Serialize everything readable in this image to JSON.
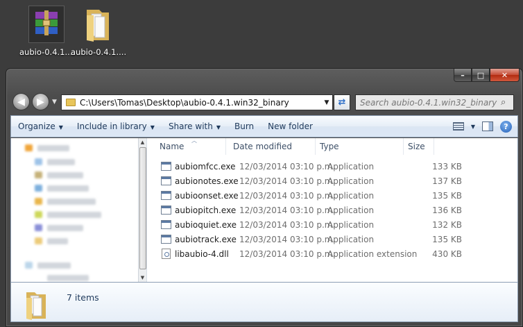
{
  "desktop": {
    "icons": [
      {
        "label": "aubio-0.4.1...."
      },
      {
        "label": "aubio-0.4.1...."
      }
    ]
  },
  "window": {
    "controls": {
      "minimize": "–",
      "maximize": "□",
      "close": "✕"
    }
  },
  "address_bar": {
    "path": "C:\\Users\\Tomas\\Desktop\\aubio-0.4.1.win32_binary"
  },
  "search": {
    "placeholder": "Search aubio-0.4.1.win32_binary"
  },
  "toolbar": {
    "organize": "Organize",
    "include_in_library": "Include in library",
    "share_with": "Share with",
    "burn": "Burn",
    "new_folder": "New folder"
  },
  "columns": {
    "name": "Name",
    "date_modified": "Date modified",
    "type": "Type",
    "size": "Size"
  },
  "files": [
    {
      "name": "aubiomfcc.exe",
      "date": "12/03/2014 03:10 p.m.",
      "type": "Application",
      "size": "133 KB"
    },
    {
      "name": "aubionotes.exe",
      "date": "12/03/2014 03:10 p.m.",
      "type": "Application",
      "size": "137 KB"
    },
    {
      "name": "aubioonset.exe",
      "date": "12/03/2014 03:10 p.m.",
      "type": "Application",
      "size": "135 KB"
    },
    {
      "name": "aubiopitch.exe",
      "date": "12/03/2014 03:10 p.m.",
      "type": "Application",
      "size": "136 KB"
    },
    {
      "name": "aubioquiet.exe",
      "date": "12/03/2014 03:10 p.m.",
      "type": "Application",
      "size": "132 KB"
    },
    {
      "name": "aubiotrack.exe",
      "date": "12/03/2014 03:10 p.m.",
      "type": "Application",
      "size": "135 KB"
    },
    {
      "name": "libaubio-4.dll",
      "date": "12/03/2014 03:10 p.m.",
      "type": "Application extension",
      "size": "430 KB"
    }
  ],
  "details": {
    "count": "7 items"
  }
}
